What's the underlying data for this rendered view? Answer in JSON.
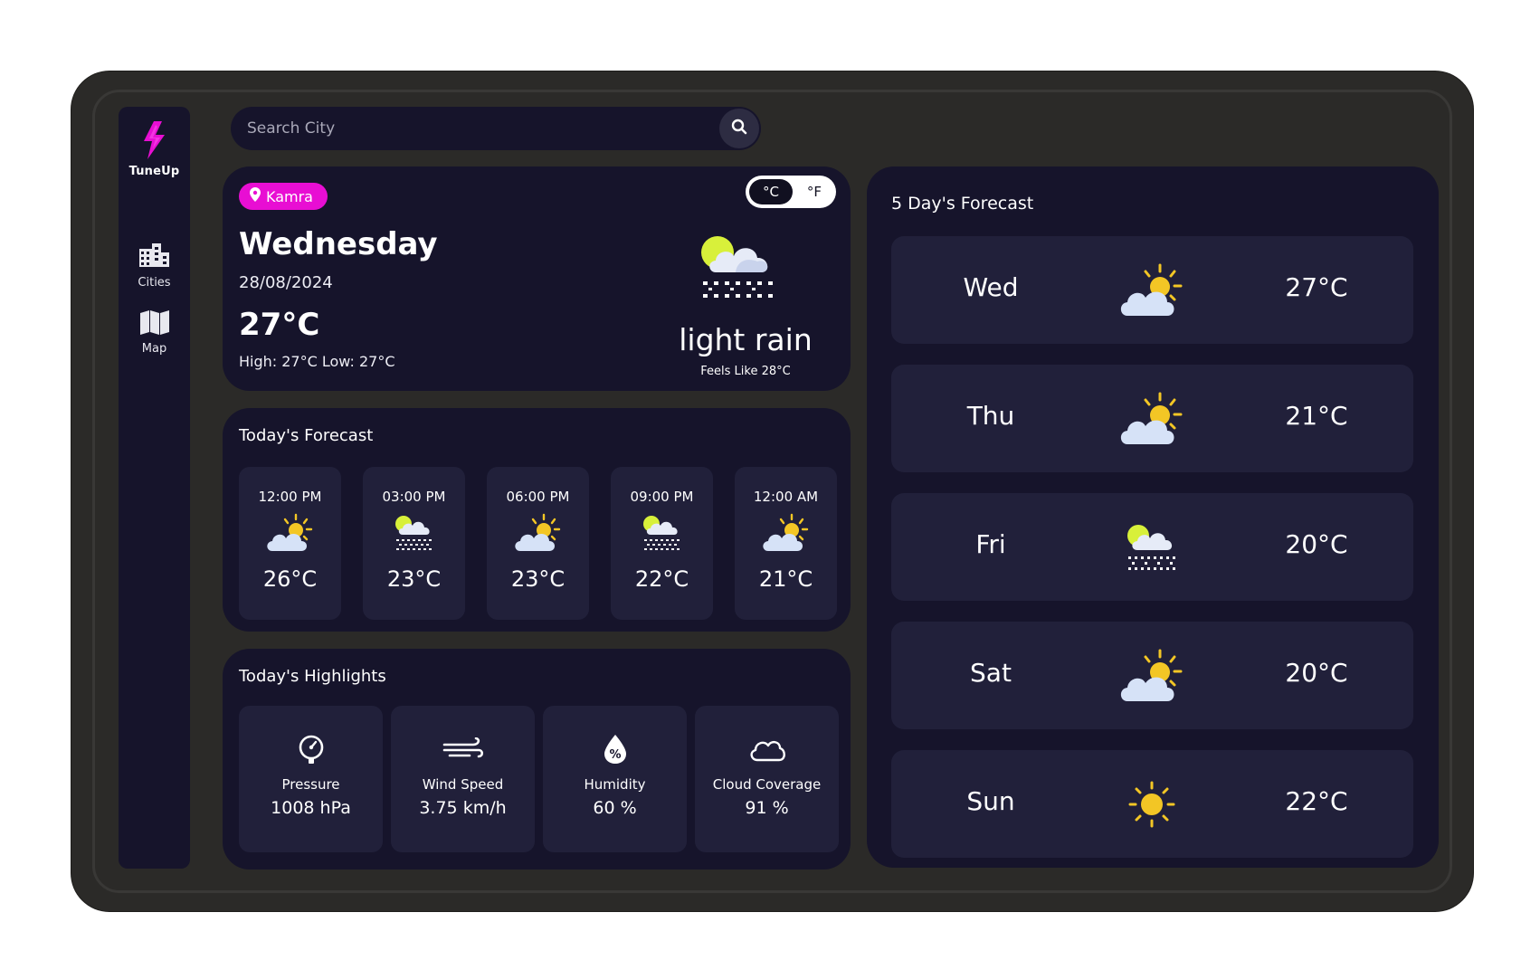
{
  "brand": {
    "name": "TuneUp",
    "accent": "#e80ed3"
  },
  "nav": [
    {
      "label": "Cities",
      "icon": "city-icon"
    },
    {
      "label": "Map",
      "icon": "map-icon"
    }
  ],
  "search": {
    "placeholder": "Search City",
    "value": ""
  },
  "current": {
    "location": "Kamra",
    "day": "Wednesday",
    "date": "28/08/2024",
    "temp": "27°C",
    "high_low": "High: 27°C Low: 27°C",
    "condition": "light rain",
    "feels_like": "Feels Like 28°C",
    "icon": "rain-cloud-icon",
    "units": {
      "celsius": "°C",
      "fahrenheit": "°F",
      "selected": "°C"
    }
  },
  "today": {
    "title": "Today's Forecast",
    "hours": [
      {
        "time": "12:00 PM",
        "temp": "26°C",
        "icon": "partly-sunny-icon"
      },
      {
        "time": "03:00 PM",
        "temp": "23°C",
        "icon": "rain-cloud-icon"
      },
      {
        "time": "06:00 PM",
        "temp": "23°C",
        "icon": "partly-sunny-icon"
      },
      {
        "time": "09:00 PM",
        "temp": "22°C",
        "icon": "rain-cloud-icon"
      },
      {
        "time": "12:00 AM",
        "temp": "21°C",
        "icon": "partly-sunny-icon"
      }
    ]
  },
  "highlights": {
    "title": "Today's Highlights",
    "items": [
      {
        "name": "Pressure",
        "value": "1008 hPa",
        "icon": "gauge-icon"
      },
      {
        "name": "Wind Speed",
        "value": "3.75 km/h",
        "icon": "wind-icon"
      },
      {
        "name": "Humidity",
        "value": "60 %",
        "icon": "humidity-icon"
      },
      {
        "name": "Cloud Coverage",
        "value": "91 %",
        "icon": "cloud-icon"
      }
    ]
  },
  "five_day": {
    "title": "5 Day's Forecast",
    "days": [
      {
        "day": "Wed",
        "temp": "27°C",
        "icon": "partly-sunny-icon"
      },
      {
        "day": "Thu",
        "temp": "21°C",
        "icon": "partly-sunny-icon"
      },
      {
        "day": "Fri",
        "temp": "20°C",
        "icon": "rain-cloud-icon"
      },
      {
        "day": "Sat",
        "temp": "20°C",
        "icon": "partly-sunny-icon"
      },
      {
        "day": "Sun",
        "temp": "22°C",
        "icon": "sun-icon"
      }
    ]
  }
}
